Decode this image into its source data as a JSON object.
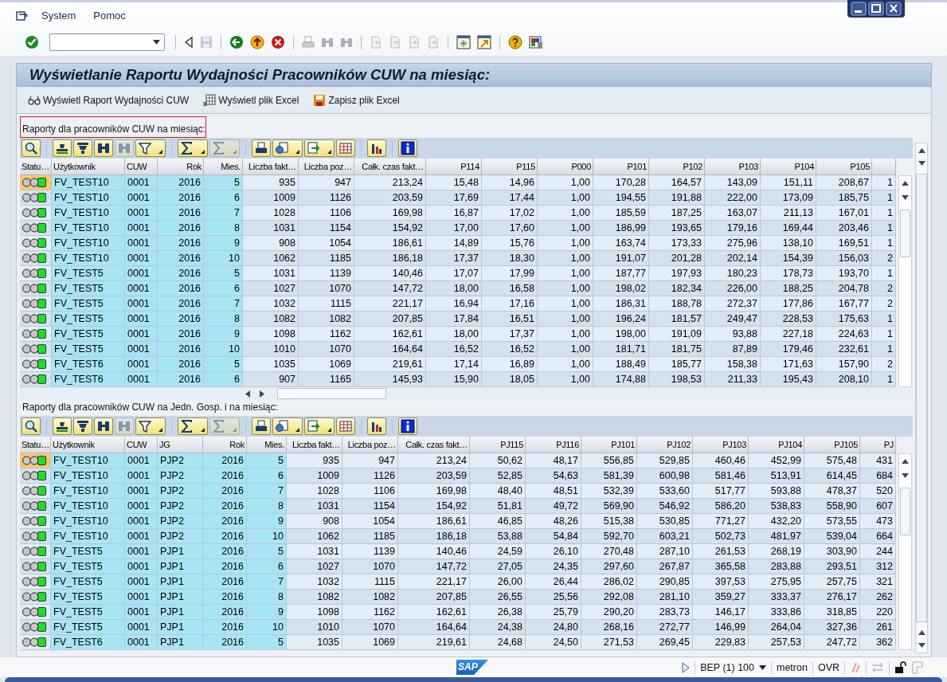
{
  "menu": [
    {
      "label": "System"
    },
    {
      "label": "Pomoc"
    }
  ],
  "system_toolbar": [
    {
      "disabled": false
    },
    {
      "disabled": false
    },
    {
      "disabled": true
    },
    {
      "disabled": false
    },
    {
      "disabled": false
    },
    {
      "disabled": false
    },
    {
      "disabled": true
    },
    {
      "disabled": true
    },
    {
      "disabled": true
    },
    {
      "disabled": true
    },
    {
      "disabled": true
    },
    {
      "disabled": true
    },
    {
      "disabled": true
    },
    {
      "disabled": false
    },
    {
      "disabled": false
    },
    {
      "disabled": false
    },
    {
      "disabled": false
    }
  ],
  "title": "Wyświetlanie Raportu Wydajności Pracowników CUW na miesiąc:",
  "app_toolbar": [
    {
      "kind": "glasses",
      "label": "Wyświetl Raport Wydajności CUW"
    },
    {
      "kind": "excel",
      "label": "Wyświetl plik Excel"
    },
    {
      "kind": "save",
      "label": "Zapisz plik Excel"
    }
  ],
  "tables": [
    {
      "title": "Raporty dla pracowników CUW na miesiąc:",
      "focused": true,
      "toolbar": [
        {
          "disabled": false,
          "menu": false
        },
        {
          "disabled": false,
          "menu": false
        },
        {
          "disabled": false,
          "menu": false
        },
        {
          "disabled": false,
          "menu": false
        },
        {
          "disabled": true,
          "menu": false
        },
        {
          "disabled": false,
          "menu": true
        },
        {
          "disabled": false,
          "menu": true
        },
        {
          "disabled": true,
          "menu": true
        },
        {
          "disabled": false,
          "menu": false
        },
        {
          "disabled": false,
          "menu": true
        },
        {
          "disabled": false,
          "menu": true
        },
        {
          "disabled": false,
          "menu": false
        },
        {
          "disabled": false,
          "menu": false
        },
        {
          "disabled": false,
          "menu": false
        }
      ],
      "status_header": "Statu…",
      "columns": [
        {
          "label": "Użytkownik",
          "key": true,
          "numeric": false
        },
        {
          "label": "CUW",
          "key": true,
          "numeric": false
        },
        {
          "label": "Rok",
          "key": true,
          "numeric": true
        },
        {
          "label": "Mies.",
          "key": true,
          "numeric": true
        },
        {
          "label": "Liczba fakt…",
          "key": false,
          "numeric": true
        },
        {
          "label": "Liczba poz…",
          "key": false,
          "numeric": true
        },
        {
          "label": "Całk. czas fakt…",
          "key": false,
          "numeric": true
        },
        {
          "label": "P114",
          "key": false,
          "numeric": true
        },
        {
          "label": "P115",
          "key": false,
          "numeric": true
        },
        {
          "label": "P000",
          "key": false,
          "numeric": true
        },
        {
          "label": "P101",
          "key": false,
          "numeric": true
        },
        {
          "label": "P102",
          "key": false,
          "numeric": true
        },
        {
          "label": "P103",
          "key": false,
          "numeric": true
        },
        {
          "label": "P104",
          "key": false,
          "numeric": true
        },
        {
          "label": "P105",
          "key": false,
          "numeric": true
        },
        {
          "key": false,
          "numeric": true
        }
      ],
      "rows": [
        {
          "color": "#22dd22",
          "selected": true,
          "cells": [
            "FV_TEST10",
            "0001",
            "2016",
            "5",
            "935",
            "947",
            "213,24",
            "15,48",
            "14,96",
            "1,00",
            "170,28",
            "164,57",
            "143,09",
            "151,11",
            "208,67",
            "1"
          ]
        },
        {
          "color": "#22dd22",
          "selected": false,
          "cells": [
            "FV_TEST10",
            "0001",
            "2016",
            "6",
            "1009",
            "1126",
            "203,59",
            "17,69",
            "17,44",
            "1,00",
            "194,55",
            "191,88",
            "222,00",
            "173,09",
            "185,75",
            "1"
          ]
        },
        {
          "color": "#22dd22",
          "selected": false,
          "cells": [
            "FV_TEST10",
            "0001",
            "2016",
            "7",
            "1028",
            "1106",
            "169,98",
            "16,87",
            "17,02",
            "1,00",
            "185,59",
            "187,25",
            "163,07",
            "211,13",
            "167,01",
            "1"
          ]
        },
        {
          "color": "#22dd22",
          "selected": false,
          "cells": [
            "FV_TEST10",
            "0001",
            "2016",
            "8",
            "1031",
            "1154",
            "154,92",
            "17,00",
            "17,60",
            "1,00",
            "186,99",
            "193,65",
            "179,16",
            "169,44",
            "203,46",
            "1"
          ]
        },
        {
          "color": "#22dd22",
          "selected": false,
          "cells": [
            "FV_TEST10",
            "0001",
            "2016",
            "9",
            "908",
            "1054",
            "186,61",
            "14,89",
            "15,76",
            "1,00",
            "163,74",
            "173,33",
            "275,96",
            "138,10",
            "169,51",
            "1"
          ]
        },
        {
          "color": "#22dd22",
          "selected": false,
          "cells": [
            "FV_TEST10",
            "0001",
            "2016",
            "10",
            "1062",
            "1185",
            "186,18",
            "17,37",
            "18,30",
            "1,00",
            "191,07",
            "201,28",
            "202,14",
            "154,39",
            "156,03",
            "2"
          ]
        },
        {
          "color": "#22dd22",
          "selected": false,
          "cells": [
            "FV_TEST5",
            "0001",
            "2016",
            "5",
            "1031",
            "1139",
            "140,46",
            "17,07",
            "17,99",
            "1,00",
            "187,77",
            "197,93",
            "180,23",
            "178,73",
            "193,70",
            "1"
          ]
        },
        {
          "color": "#22dd22",
          "selected": false,
          "cells": [
            "FV_TEST5",
            "0001",
            "2016",
            "6",
            "1027",
            "1070",
            "147,72",
            "18,00",
            "16,58",
            "1,00",
            "198,02",
            "182,34",
            "226,00",
            "188,25",
            "204,78",
            "2"
          ]
        },
        {
          "color": "#22dd22",
          "selected": false,
          "cells": [
            "FV_TEST5",
            "0001",
            "2016",
            "7",
            "1032",
            "1115",
            "221,17",
            "16,94",
            "17,16",
            "1,00",
            "186,31",
            "188,78",
            "272,37",
            "177,86",
            "167,77",
            "2"
          ]
        },
        {
          "color": "#22dd22",
          "selected": false,
          "cells": [
            "FV_TEST5",
            "0001",
            "2016",
            "8",
            "1082",
            "1082",
            "207,85",
            "17,84",
            "16,51",
            "1,00",
            "196,24",
            "181,57",
            "249,47",
            "228,53",
            "175,63",
            "1"
          ]
        },
        {
          "color": "#22dd22",
          "selected": false,
          "cells": [
            "FV_TEST5",
            "0001",
            "2016",
            "9",
            "1098",
            "1162",
            "162,61",
            "18,00",
            "17,37",
            "1,00",
            "198,00",
            "191,09",
            "93,88",
            "227,18",
            "224,63",
            "1"
          ]
        },
        {
          "color": "#22dd22",
          "selected": false,
          "cells": [
            "FV_TEST5",
            "0001",
            "2016",
            "10",
            "1010",
            "1070",
            "164,64",
            "16,52",
            "16,52",
            "1,00",
            "181,71",
            "181,75",
            "87,89",
            "179,46",
            "232,61",
            "1"
          ]
        },
        {
          "color": "#22dd22",
          "selected": false,
          "cells": [
            "FV_TEST6",
            "0001",
            "2016",
            "5",
            "1035",
            "1069",
            "219,61",
            "17,14",
            "16,89",
            "1,00",
            "188,49",
            "185,77",
            "158,38",
            "171,63",
            "157,90",
            "2"
          ]
        },
        {
          "color": "#22dd22",
          "selected": false,
          "cells": [
            "FV_TEST6",
            "0001",
            "2016",
            "6",
            "907",
            "1165",
            "145,93",
            "15,90",
            "18,05",
            "1,00",
            "174,88",
            "198,53",
            "211,33",
            "195,43",
            "208,10",
            "1"
          ]
        }
      ]
    },
    {
      "title": "Raporty dla pracowników CUW na Jedn. Gosp. i na miesiąc:",
      "focused": false,
      "toolbar": [
        {
          "disabled": false,
          "menu": false
        },
        {
          "disabled": false,
          "menu": false
        },
        {
          "disabled": false,
          "menu": false
        },
        {
          "disabled": false,
          "menu": false
        },
        {
          "disabled": true,
          "menu": false
        },
        {
          "disabled": false,
          "menu": true
        },
        {
          "disabled": false,
          "menu": true
        },
        {
          "disabled": true,
          "menu": true
        },
        {
          "disabled": false,
          "menu": false
        },
        {
          "disabled": false,
          "menu": true
        },
        {
          "disabled": false,
          "menu": true
        },
        {
          "disabled": false,
          "menu": false
        },
        {
          "disabled": false,
          "menu": false
        },
        {
          "disabled": false,
          "menu": false
        }
      ],
      "status_header": "Statu…",
      "columns": [
        {
          "label": "Użytkownik",
          "key": true,
          "numeric": false
        },
        {
          "label": "CUW",
          "key": true,
          "numeric": false
        },
        {
          "label": "JG",
          "key": true,
          "numeric": false
        },
        {
          "label": "Rok",
          "key": true,
          "numeric": true
        },
        {
          "label": "Mies.",
          "key": true,
          "numeric": true
        },
        {
          "label": "Liczba fakt…",
          "key": false,
          "numeric": true
        },
        {
          "label": "Liczba poz…",
          "key": false,
          "numeric": true
        },
        {
          "label": "Całk. czas fakt…",
          "key": false,
          "numeric": true
        },
        {
          "label": "PJ115",
          "key": false,
          "numeric": true
        },
        {
          "label": "PJ116",
          "key": false,
          "numeric": true
        },
        {
          "label": "PJ101",
          "key": false,
          "numeric": true
        },
        {
          "label": "PJ102",
          "key": false,
          "numeric": true
        },
        {
          "label": "PJ103",
          "key": false,
          "numeric": true
        },
        {
          "label": "PJ104",
          "key": false,
          "numeric": true
        },
        {
          "label": "PJ105",
          "key": false,
          "numeric": true
        },
        {
          "label": "PJ",
          "key": false,
          "numeric": true
        }
      ],
      "rows": [
        {
          "color": "#22dd22",
          "selected": true,
          "cells": [
            "FV_TEST10",
            "0001",
            "PJP2",
            "2016",
            "5",
            "935",
            "947",
            "213,24",
            "50,62",
            "48,17",
            "556,85",
            "529,85",
            "460,46",
            "452,99",
            "575,48",
            "431"
          ]
        },
        {
          "color": "#22dd22",
          "selected": false,
          "cells": [
            "FV_TEST10",
            "0001",
            "PJP2",
            "2016",
            "6",
            "1009",
            "1126",
            "203,59",
            "52,85",
            "54,63",
            "581,39",
            "600,98",
            "581,46",
            "513,91",
            "614,45",
            "684"
          ]
        },
        {
          "color": "#22dd22",
          "selected": false,
          "cells": [
            "FV_TEST10",
            "0001",
            "PJP2",
            "2016",
            "7",
            "1028",
            "1106",
            "169,98",
            "48,40",
            "48,51",
            "532,39",
            "533,60",
            "517,77",
            "593,88",
            "478,37",
            "520"
          ]
        },
        {
          "color": "#22dd22",
          "selected": false,
          "cells": [
            "FV_TEST10",
            "0001",
            "PJP2",
            "2016",
            "8",
            "1031",
            "1154",
            "154,92",
            "51,81",
            "49,72",
            "569,90",
            "546,92",
            "586,20",
            "538,83",
            "558,90",
            "607"
          ]
        },
        {
          "color": "#22dd22",
          "selected": false,
          "cells": [
            "FV_TEST10",
            "0001",
            "PJP2",
            "2016",
            "9",
            "908",
            "1054",
            "186,61",
            "46,85",
            "48,26",
            "515,38",
            "530,85",
            "771,27",
            "432,20",
            "573,55",
            "473"
          ]
        },
        {
          "color": "#22dd22",
          "selected": false,
          "cells": [
            "FV_TEST10",
            "0001",
            "PJP2",
            "2016",
            "10",
            "1062",
            "1185",
            "186,18",
            "53,88",
            "54,84",
            "592,70",
            "603,21",
            "502,73",
            "481,97",
            "539,04",
            "664"
          ]
        },
        {
          "color": "#22dd22",
          "selected": false,
          "cells": [
            "FV_TEST5",
            "0001",
            "PJP1",
            "2016",
            "5",
            "1031",
            "1139",
            "140,46",
            "24,59",
            "26,10",
            "270,48",
            "287,10",
            "261,53",
            "268,19",
            "303,90",
            "244"
          ]
        },
        {
          "color": "#22dd22",
          "selected": false,
          "cells": [
            "FV_TEST5",
            "0001",
            "PJP1",
            "2016",
            "6",
            "1027",
            "1070",
            "147,72",
            "27,05",
            "24,35",
            "297,60",
            "267,87",
            "365,58",
            "283,88",
            "293,51",
            "312"
          ]
        },
        {
          "color": "#22dd22",
          "selected": false,
          "cells": [
            "FV_TEST5",
            "0001",
            "PJP1",
            "2016",
            "7",
            "1032",
            "1115",
            "221,17",
            "26,00",
            "26,44",
            "286,02",
            "290,85",
            "397,53",
            "275,95",
            "257,75",
            "321"
          ]
        },
        {
          "color": "#22dd22",
          "selected": false,
          "cells": [
            "FV_TEST5",
            "0001",
            "PJP1",
            "2016",
            "8",
            "1082",
            "1082",
            "207,85",
            "26,55",
            "25,56",
            "292,08",
            "281,10",
            "359,27",
            "333,37",
            "276,17",
            "262"
          ]
        },
        {
          "color": "#22dd22",
          "selected": false,
          "cells": [
            "FV_TEST5",
            "0001",
            "PJP1",
            "2016",
            "9",
            "1098",
            "1162",
            "162,61",
            "26,38",
            "25,79",
            "290,20",
            "283,73",
            "146,17",
            "333,86",
            "318,85",
            "220"
          ]
        },
        {
          "color": "#22dd22",
          "selected": false,
          "cells": [
            "FV_TEST5",
            "0001",
            "PJP1",
            "2016",
            "10",
            "1010",
            "1070",
            "164,64",
            "24,38",
            "24,80",
            "268,16",
            "272,77",
            "146,99",
            "264,04",
            "327,36",
            "261"
          ]
        },
        {
          "color": "#22dd22",
          "selected": false,
          "cells": [
            "FV_TEST6",
            "0001",
            "PJP1",
            "2016",
            "5",
            "1035",
            "1069",
            "219,61",
            "24,68",
            "24,50",
            "271,53",
            "269,45",
            "229,83",
            "257,53",
            "247,72",
            "362"
          ]
        }
      ]
    }
  ],
  "status_bar": {
    "logo": "SAP",
    "system": "BEP (1) 100",
    "server": "metron",
    "mode": "OVR"
  }
}
